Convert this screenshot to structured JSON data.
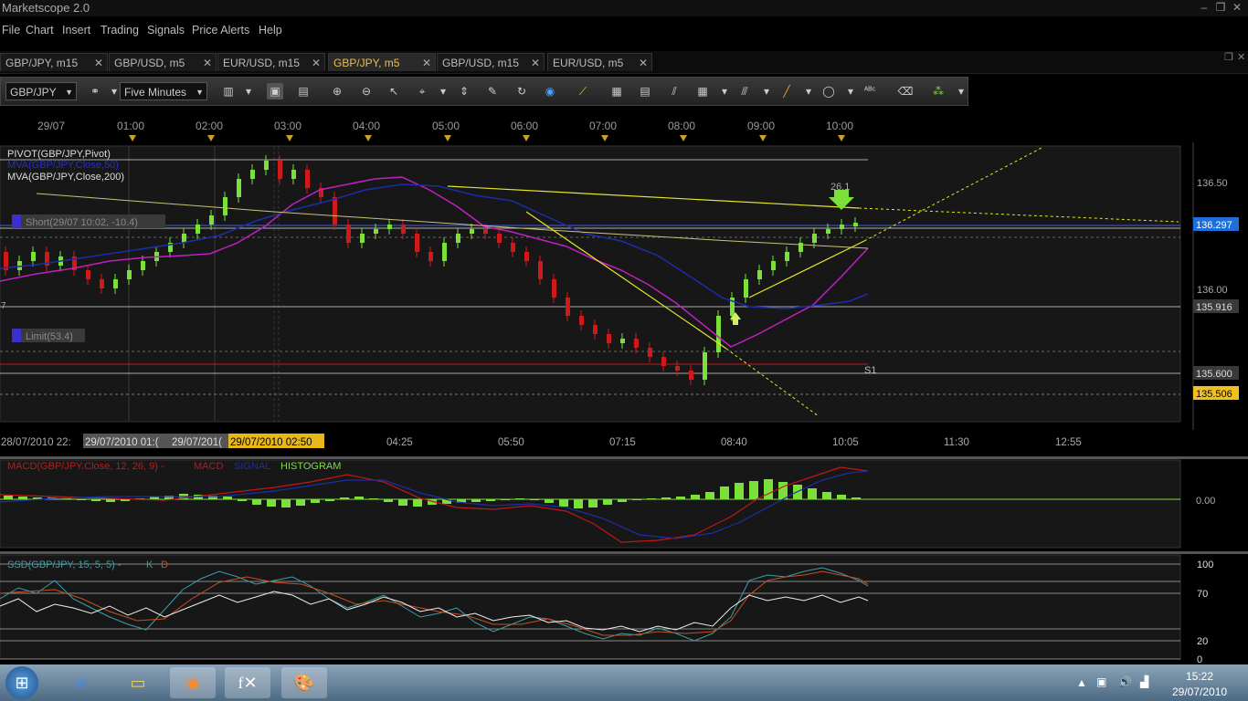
{
  "window": {
    "title": "Marketscope 2.0",
    "controls": [
      "–",
      "❐",
      "✕"
    ]
  },
  "menu": [
    "File",
    "Chart",
    "Insert",
    "Trading",
    "Signals",
    "Price Alerts",
    "Help"
  ],
  "tabs": [
    {
      "label": "GBP/JPY, m15",
      "active": false
    },
    {
      "label": "GBP/USD, m5",
      "active": false
    },
    {
      "label": "EUR/USD, m15",
      "active": false
    },
    {
      "label": "GBP/JPY, m5",
      "active": true
    },
    {
      "label": "GBP/USD, m15",
      "active": false
    },
    {
      "label": "EUR/USD, m5",
      "active": false
    }
  ],
  "toolbar": {
    "instrument": "GBP/JPY",
    "timeframe": "Five Minutes"
  },
  "time_top": [
    "29/07",
    "01:00",
    "02:00",
    "03:00",
    "04:00",
    "05:00",
    "06:00",
    "07:00",
    "08:00",
    "09:00",
    "10:00"
  ],
  "time_bottom": [
    "28/07/2010 22:",
    "29/07/2010 01:(",
    "29/07/201(",
    "29/07/2010 02:50",
    "04:25",
    "05:50",
    "07:15",
    "08:40",
    "10:05",
    "11:30",
    "12:55"
  ],
  "price": {
    "indicators": [
      "PIVOT(GBP/JPY,Pivot)",
      "MVA(GBP/JPY,Close,50)",
      "MVA(GBP/JPY,Close,200)"
    ],
    "orders": {
      "short": "Short(29/07 10:02, -10.4)",
      "limit": "Limit(53.4)"
    },
    "axis_ticks": [
      "136.50",
      "136.00"
    ],
    "price_tags": [
      {
        "label": "136.297",
        "color": "#1e6fd9"
      },
      {
        "label": "135.916",
        "color": "#3a3a3a"
      },
      {
        "label": "135.600",
        "color": "#3a3a3a"
      },
      {
        "label": "135.506",
        "color": "#f0c020"
      }
    ],
    "annotations": {
      "value": "26.1",
      "s1": "S1",
      "left_cut": "7"
    }
  },
  "macd": {
    "title": "MACD(GBP/JPY.Close, 12, 26, 9) -",
    "macd": "MACD",
    "signal": "SIGNAL",
    "hist": "HISTOGRAM",
    "zero": "0.00"
  },
  "ssd": {
    "title": "SSD(GBP/JPY, 15, 5, 5) -",
    "k": "K",
    "d": "D",
    "levels": [
      "100",
      "70",
      "20",
      "0"
    ]
  },
  "taskbar": {
    "time": "15:22",
    "date": "29/07/2010"
  },
  "colors": {
    "bull": "#7be03a",
    "bear": "#d01a1a",
    "ma50": "#c020c0",
    "ma200": "#1a2fa8",
    "trend": "#e6e62a",
    "accent": "#e8c04a"
  }
}
